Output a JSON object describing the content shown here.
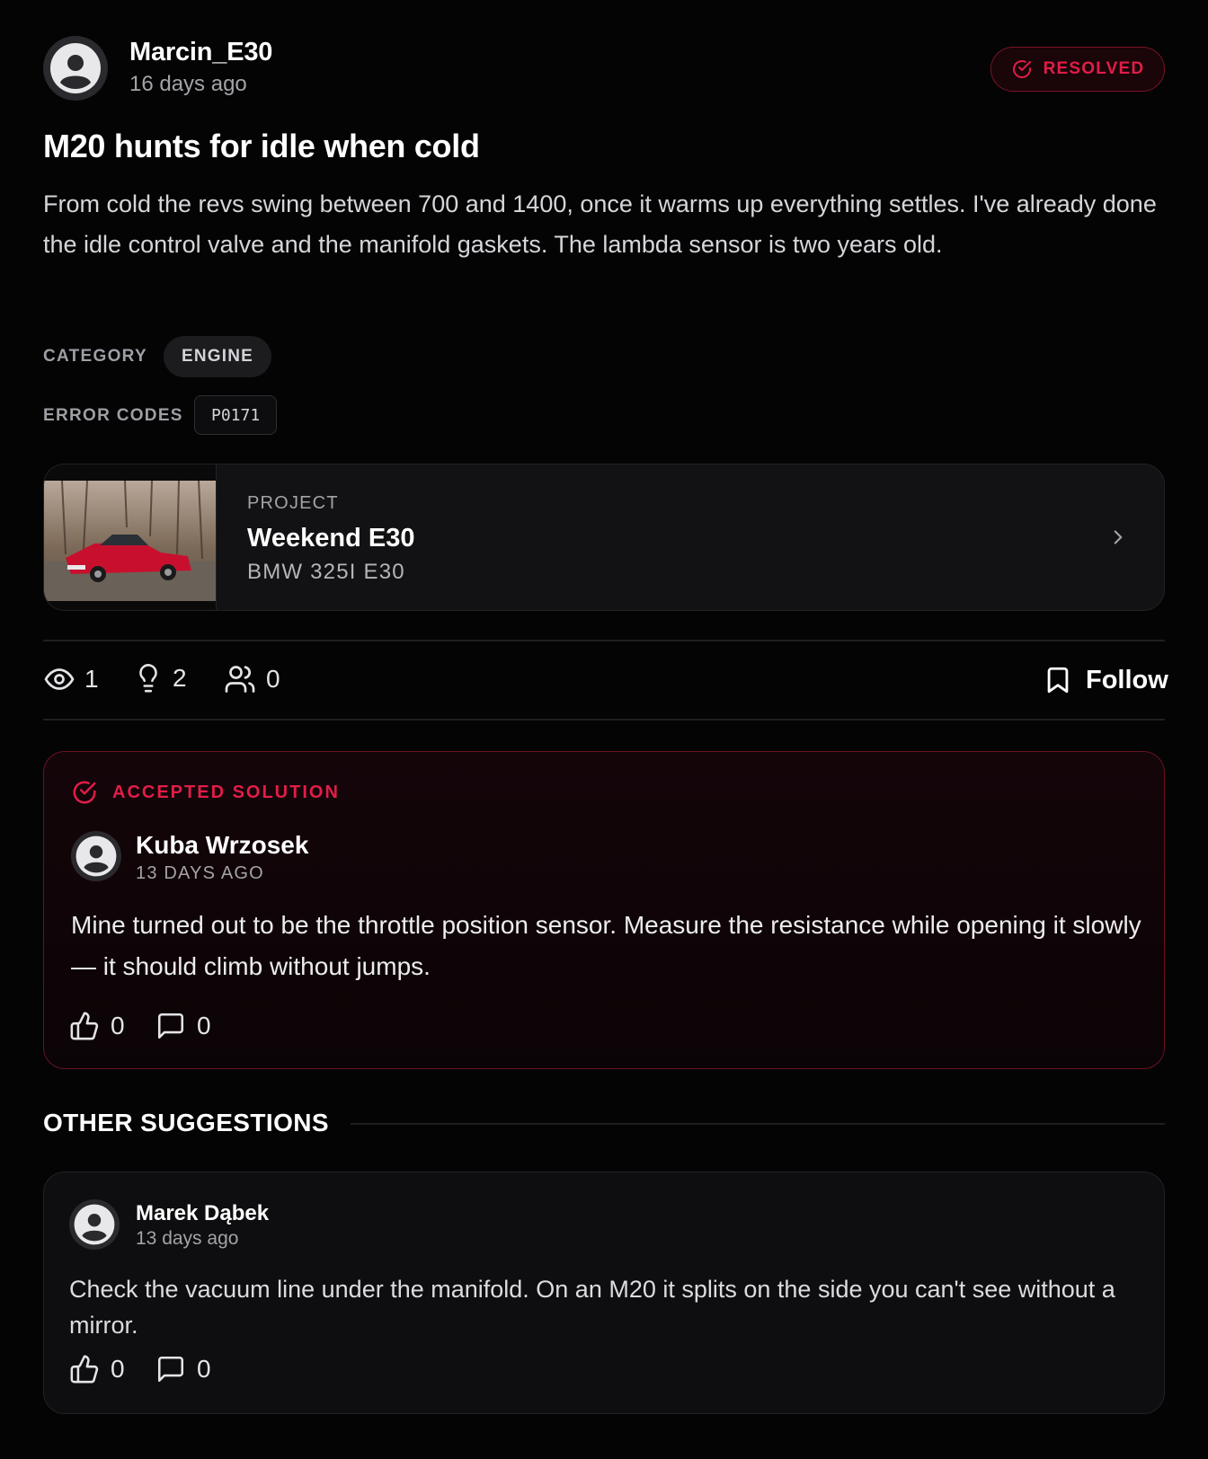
{
  "post": {
    "author": "Marcin_E30",
    "time": "16 days ago",
    "status": "RESOLVED",
    "title": "M20 hunts for idle when cold",
    "body": "From cold the revs swing between 700 and 1400, once it warms up everything settles. I've already done the idle control valve and the manifold gaskets. The lambda sensor is two years old.",
    "category_label": "CATEGORY",
    "category": "ENGINE",
    "error_codes_label": "ERROR CODES",
    "error_codes": [
      "P0171"
    ]
  },
  "project": {
    "label": "PROJECT",
    "name": "Weekend E30",
    "model": "BMW 325I E30"
  },
  "stats": {
    "views": "1",
    "ideas": "2",
    "participants": "0",
    "follow_label": "Follow"
  },
  "accepted": {
    "header": "ACCEPTED SOLUTION",
    "author": "Kuba Wrzosek",
    "time": "13 DAYS AGO",
    "body": "Mine turned out to be the throttle position sensor. Measure the resistance while opening it slowly — it should climb without jumps.",
    "likes": "0",
    "comments": "0"
  },
  "other": {
    "title": "OTHER SUGGESTIONS",
    "items": [
      {
        "author": "Marek Dąbek",
        "time": "13 days ago",
        "body": "Check the vacuum line under the manifold. On an M20 it splits on the side you can't see without a mirror.",
        "likes": "0",
        "comments": "0"
      }
    ]
  },
  "colors": {
    "accent": "#e11d48",
    "background": "#040405",
    "card": "#121214"
  },
  "icons": [
    "user-avatar-icon",
    "check-circle-icon",
    "chevron-right-icon",
    "eye-icon",
    "lightbulb-icon",
    "users-icon",
    "bookmark-icon",
    "thumbs-up-icon",
    "comment-icon"
  ]
}
